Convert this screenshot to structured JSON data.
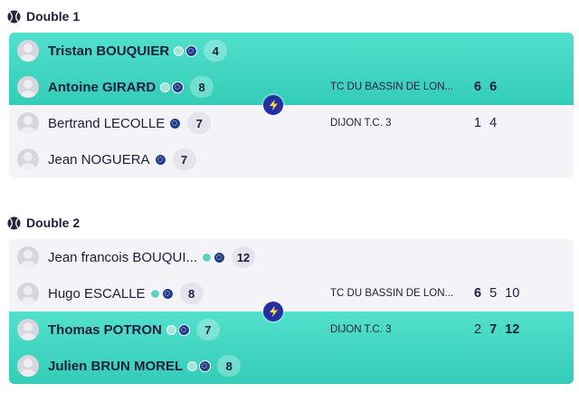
{
  "matches": [
    {
      "title": "Double 1",
      "teams": [
        {
          "winner": true,
          "club": "TC DU BASSIN DE LON...",
          "scores": [
            {
              "value": "6",
              "won": true
            },
            {
              "value": "6",
              "won": true
            }
          ],
          "players": [
            {
              "name": "Tristan BOUQUIER",
              "rank": "4"
            },
            {
              "name": "Antoine GIRARD",
              "rank": "8"
            }
          ]
        },
        {
          "winner": false,
          "club": "DIJON T.C. 3",
          "scores": [
            {
              "value": "1",
              "won": false
            },
            {
              "value": "4",
              "won": false
            }
          ],
          "players": [
            {
              "name": "Bertrand LECOLLE",
              "rank": "7"
            },
            {
              "name": "Jean NOGUERA",
              "rank": "7"
            }
          ]
        }
      ]
    },
    {
      "title": "Double 2",
      "teams": [
        {
          "winner": false,
          "club": "TC DU BASSIN DE LON...",
          "scores": [
            {
              "value": "6",
              "won": true
            },
            {
              "value": "5",
              "won": false
            },
            {
              "value": "10",
              "won": false
            }
          ],
          "players": [
            {
              "name": "Jean francois BOUQUI...",
              "rank": "12"
            },
            {
              "name": "Hugo ESCALLE",
              "rank": "8"
            }
          ]
        },
        {
          "winner": true,
          "club": "DIJON T.C. 3",
          "scores": [
            {
              "value": "2",
              "won": false
            },
            {
              "value": "7",
              "won": true
            },
            {
              "value": "12",
              "won": true
            }
          ],
          "players": [
            {
              "name": "Thomas POTRON",
              "rank": "7"
            },
            {
              "name": "Julien BRUN MOREL",
              "rank": "8"
            }
          ]
        }
      ]
    }
  ],
  "icons": {
    "section": "tennis-ball-icon",
    "vs": "lightning-bolt-icon",
    "player_tag_1": "tennis-ball-badge-icon",
    "player_tag_2": "europe-flag-badge-icon",
    "avatar": "user-avatar-icon"
  },
  "colors": {
    "winner_bg": "#3fd6c1",
    "loser_bg": "#f3f3f8",
    "bolt_bg": "#262fa0",
    "text": "#1e1e3c"
  }
}
